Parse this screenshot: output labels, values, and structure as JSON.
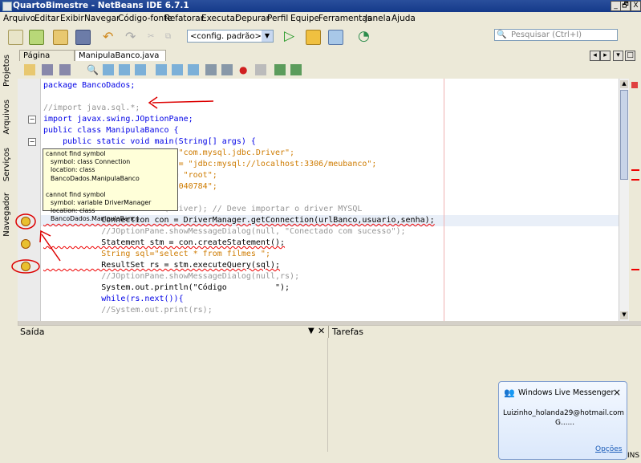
{
  "window": {
    "title": "QuartoBimestre - NetBeans IDE 6.7.1",
    "minimize": "_",
    "maximize": "🗗",
    "close": "X"
  },
  "menu": [
    "Arquivo",
    "Editar",
    "Exibir",
    "Navegar",
    "Código-fonte",
    "Refatorar",
    "Executar",
    "Depurar",
    "Perfil",
    "Equipe",
    "Ferramentas",
    "Janela",
    "Ajuda"
  ],
  "toolbar": {
    "config_value": "<config. padrão>",
    "search_placeholder": "Pesquisar (Ctrl+I)"
  },
  "sidebar_tabs": [
    "Projetos",
    "Arquivos",
    "Serviços",
    "Navegador"
  ],
  "doc_tabs": [
    {
      "label": "Página Inicial",
      "close": "×"
    },
    {
      "label": "ManipulaBanco.java *",
      "close": "×"
    }
  ],
  "code_lines": [
    "package BancoDados;",
    "",
    "//import java.sql.*;",
    "import javax.swing.JOptionPane;",
    "public class ManipulaBanco {",
    "    public static void main(String[] args) {",
    "            String driver = \"com.mysql.jdbc.Driver\";",
    "            String urlBanco = \"jdbc:mysql://localhost:3306/meubanco\";",
    "            String usuario = \"root\";",
    "            String senha = \"040784\";",
    "",
    "            Class.forName(driver); // Deve importar o driver MYSQL",
    "            Connection con = DriverManager.getConnection(urlBanco,usuario,senha);",
    "            //JOptionPane.showMessageDialog(null, \"Conectado com sucesso\");",
    "            Statement stm = con.createStatement();",
    "            String sql=\"select * from filmes \";",
    "            ResultSet rs = stm.executeQuery(sql);",
    "            //JOptionPane.showMessageDialog(null,rs);",
    "            System.out.println(\"Código          \");",
    "            while(rs.next()){",
    "            //System.out.print(rs);"
  ],
  "tooltip": {
    "line1": "cannot find symbol",
    "line2": "symbol:   class Connection",
    "line3": "location: class BancoDados.ManipulaBanco",
    "line4": "cannot find symbol",
    "line5": "symbol:   variable DriverManager",
    "line6": "location: class BancoDados.ManipulaBanco"
  },
  "output": {
    "saida_label": "Saída",
    "tarefas_label": "Tarefas"
  },
  "messenger": {
    "title": "Windows Live Messenger",
    "close": "×",
    "line1": "Luizinho_holanda29@hotmail.com",
    "line2": "G......",
    "options": "Opções"
  },
  "status": {
    "mode": "INS"
  },
  "colors": {
    "accent": "#2a4f9c",
    "error": "#e00000",
    "keyword": "#0000e6",
    "comment": "#969696",
    "string": "#ce7b00"
  }
}
